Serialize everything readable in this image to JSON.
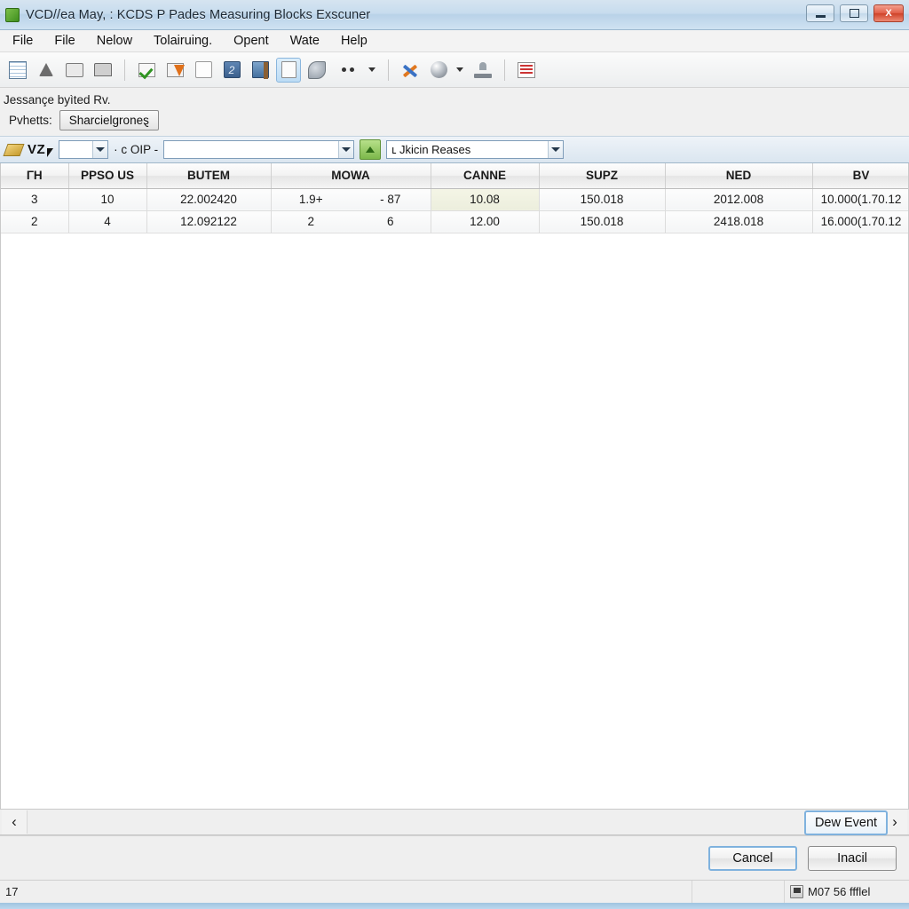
{
  "window": {
    "title": "VCD//ea May, : KCDS P Pades Measuring Blocks Exscuner",
    "app_icon": "app-icon",
    "controls": {
      "minimize": "minimize",
      "maximize": "maximize",
      "close": "X"
    }
  },
  "menu": {
    "items": [
      {
        "label": "File"
      },
      {
        "label": "File"
      },
      {
        "label": "Nelow"
      },
      {
        "label": "Tolairuing."
      },
      {
        "label": "Opent"
      },
      {
        "label": "Wate"
      },
      {
        "label": "Help"
      }
    ]
  },
  "toolbar": {
    "buttons": [
      {
        "icon": "table-grid-icon"
      },
      {
        "icon": "water-drop-icon"
      },
      {
        "icon": "card-edit-icon"
      },
      {
        "icon": "printer-icon"
      },
      {
        "icon": "checkmark-page-icon"
      },
      {
        "icon": "cancel-page-icon"
      },
      {
        "icon": "blank-page-icon"
      },
      {
        "icon": "blue-data-icon"
      },
      {
        "icon": "save-door-icon"
      },
      {
        "icon": "document-active-icon"
      },
      {
        "icon": "wrench-search-icon"
      },
      {
        "icon": "more-dots-icon"
      },
      {
        "icon": "tools-cross-icon"
      },
      {
        "icon": "sphere-globe-icon"
      },
      {
        "icon": "stamp-icon"
      },
      {
        "icon": "report-chart-icon"
      }
    ]
  },
  "subheader": {
    "message": "Jessançe byìted Rv.",
    "label": "Pvhetts:",
    "chip": "Sharcielgroneȿ"
  },
  "filterbar": {
    "badge": "VZ",
    "combo_small_value": "",
    "separator_text": "· c OIP -",
    "combo_mid_value": "",
    "green_button": "up-arrow-button",
    "combo_wide_value": "ʟ Jkicin Reases"
  },
  "table": {
    "columns": [
      "ΓH",
      "PPSO US",
      "BUTEM",
      "MOWA",
      "CANNE",
      "SUPZ",
      "NED",
      "BV"
    ],
    "rows": [
      {
        "cells": [
          "3",
          "10",
          "22.002420",
          "1.9+|- 87",
          "10.08",
          "150.018",
          "2012.008",
          "10.000(1.70.12"
        ],
        "highlight_col": 4
      },
      {
        "cells": [
          "2",
          "4",
          "12.092122",
          "2|6",
          "12.00",
          "150.018",
          "2418.018",
          "16.000(1.70.12"
        ],
        "highlight_col": -1
      }
    ]
  },
  "navstrip": {
    "prev_arrow": "‹",
    "next_arrow": "›",
    "dew_event_button": "Dew Event"
  },
  "actions": {
    "cancel": "Cancel",
    "apply": "Inacil"
  },
  "statusbar": {
    "left": "17",
    "middle": "",
    "right": "M07 56 ffflel"
  },
  "colors": {
    "titlebar": "#c7dcee",
    "close_button": "#cf4229",
    "accent_blue": "#7fb2de",
    "green_button": "#7cb84a",
    "highlight_cell": "#eceedd",
    "bottom_accent": "#9fc4e0"
  }
}
